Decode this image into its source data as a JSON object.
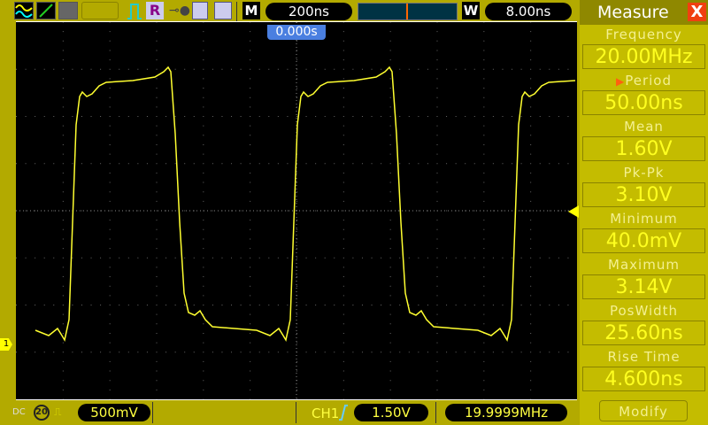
{
  "toolbar": {
    "timebase": "200ns",
    "delay": "8.00ns",
    "m_label": "M",
    "w_label": "W",
    "r_label": "R"
  },
  "trigger_position": "0.000s",
  "channel_marker": "1",
  "panel": {
    "title": "Measure",
    "close": "X",
    "items": [
      {
        "label": "Frequency",
        "value": "20.00MHz"
      },
      {
        "label": "Period",
        "value": "50.00ns",
        "selected": true
      },
      {
        "label": "Mean",
        "value": "1.60V"
      },
      {
        "label": "Pk-Pk",
        "value": "3.10V"
      },
      {
        "label": "Minimum",
        "value": "40.0mV"
      },
      {
        "label": "Maximum",
        "value": "3.14V"
      },
      {
        "label": "PosWidth",
        "value": "25.60ns"
      },
      {
        "label": "Rise Time",
        "value": "4.600ns"
      }
    ],
    "modify": "Modify"
  },
  "status": {
    "coupling": "DC",
    "bw_limit": "20",
    "volts_div": "500mV",
    "trig_source": "CH1",
    "trig_level": "1.50V",
    "counter": "19.9999MHz"
  },
  "colors": {
    "trace": "#ffff30",
    "accent": "#ff6010"
  }
}
